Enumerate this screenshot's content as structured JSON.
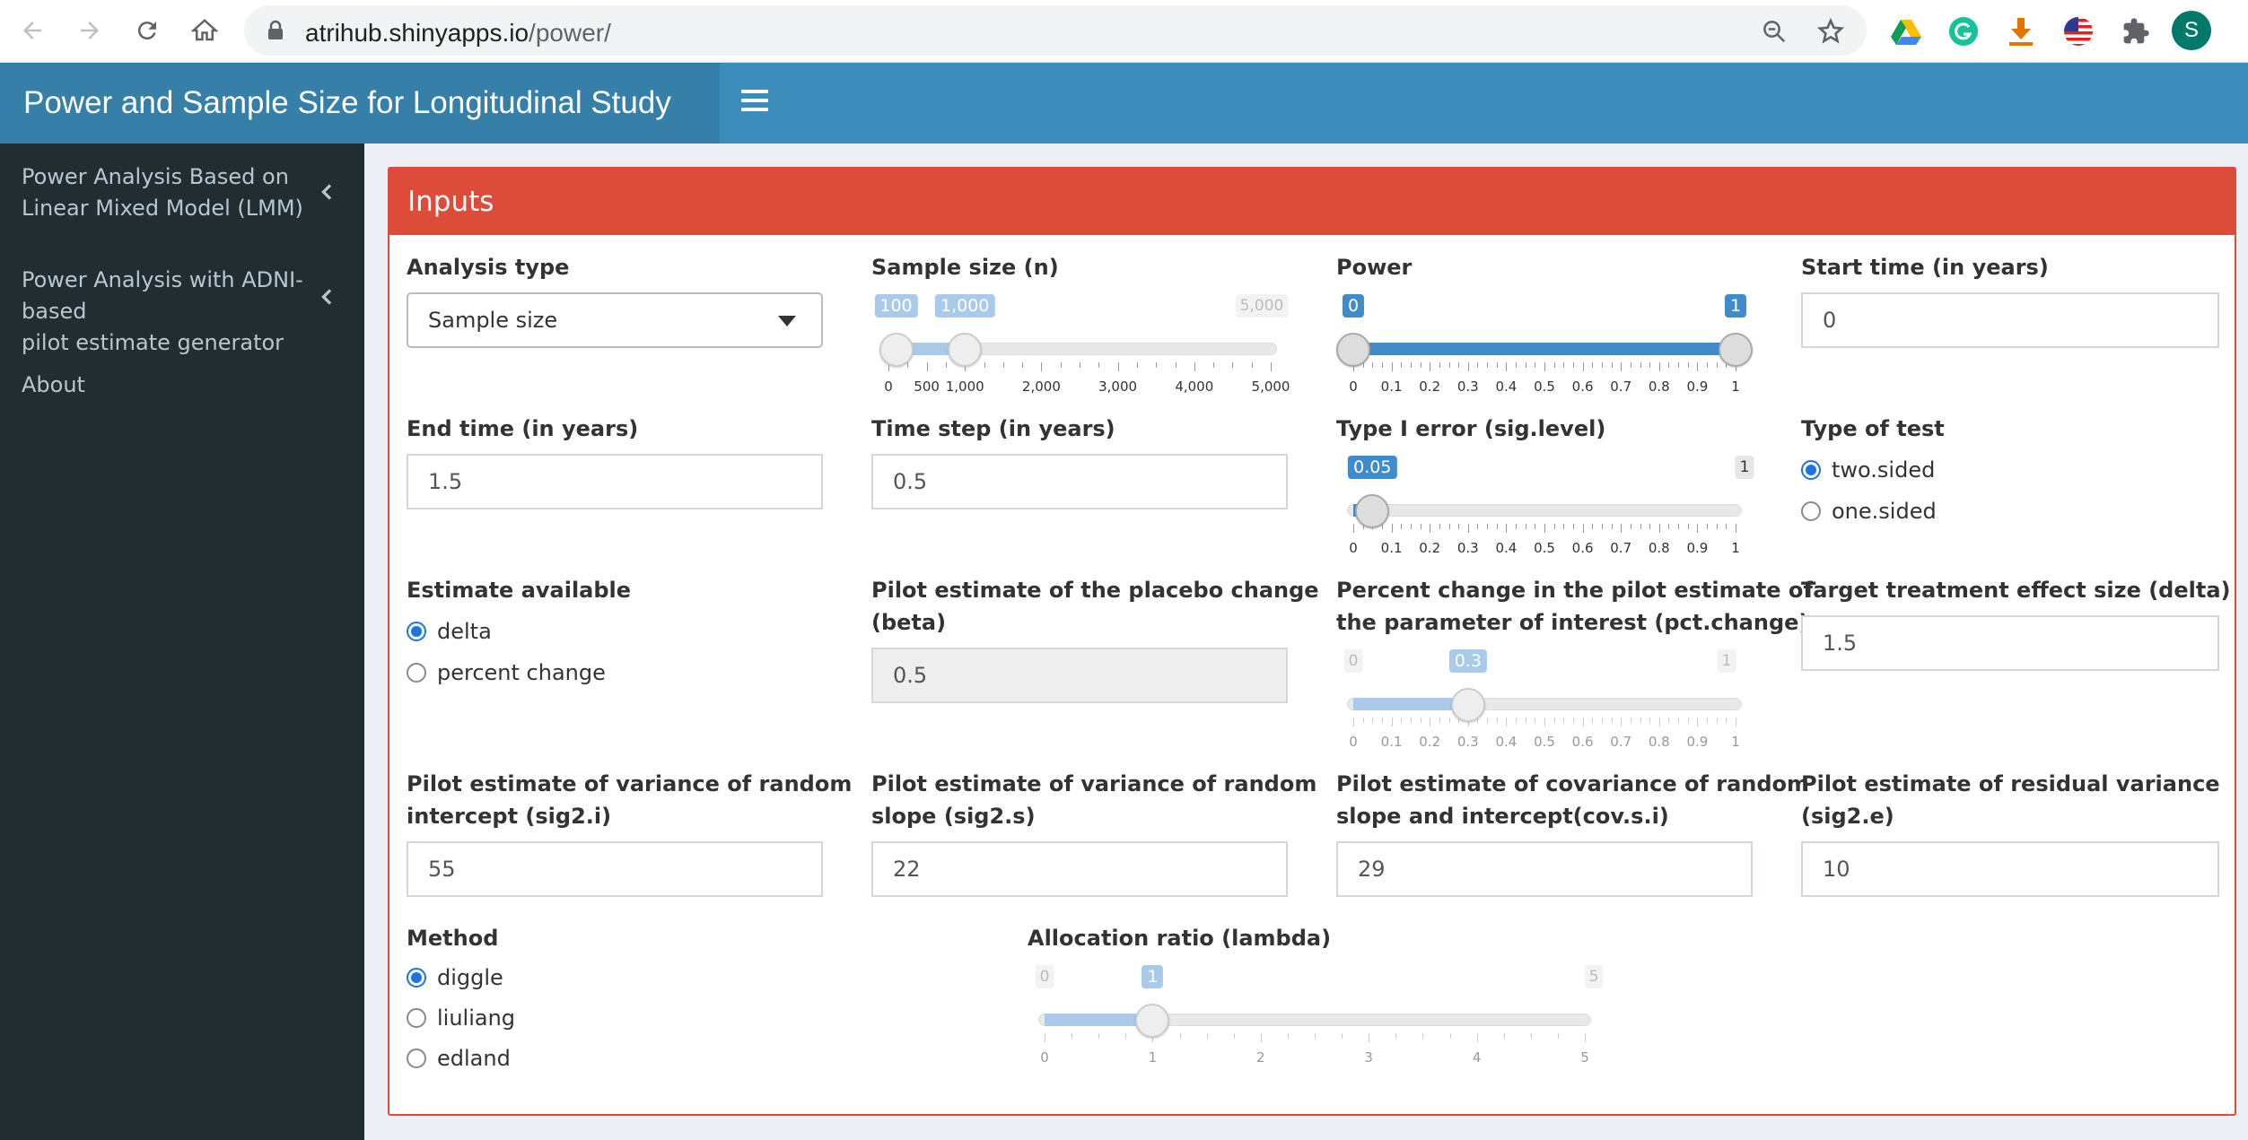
{
  "browser": {
    "url_host": "atrihub.shinyapps.io",
    "url_path": "/power/",
    "profile_initial": "S"
  },
  "header": {
    "title": "Power and Sample Size for Longitudinal Study"
  },
  "sidebar": {
    "items": [
      {
        "label_line1": "Power Analysis Based on",
        "label_line2": "Linear Mixed Model (LMM)"
      },
      {
        "label_line1": "Power Analysis with ADNI-based",
        "label_line2": "pilot estimate generator"
      },
      {
        "label_line1": "About",
        "label_line2": ""
      }
    ]
  },
  "box": {
    "title": "Inputs"
  },
  "fields": {
    "analysis_type": {
      "label": "Analysis type",
      "value": "Sample size"
    },
    "sample_size": {
      "label": "Sample size (n)",
      "min": 0,
      "max": 5000,
      "low": 100,
      "high": 1000,
      "low_text": "100",
      "high_text": "1,000",
      "max_text": "5,000",
      "ticks": [
        "0",
        "500",
        "1,000",
        "2,000",
        "3,000",
        "4,000",
        "5,000"
      ]
    },
    "power": {
      "label": "Power",
      "min": 0,
      "max": 1,
      "low": 0,
      "high": 1,
      "low_text": "0",
      "high_text": "1",
      "ticks": [
        "0",
        "0.1",
        "0.2",
        "0.3",
        "0.4",
        "0.5",
        "0.6",
        "0.7",
        "0.8",
        "0.9",
        "1"
      ]
    },
    "start_time": {
      "label": "Start time (in years)",
      "value": "0"
    },
    "end_time": {
      "label": "End time (in years)",
      "value": "1.5"
    },
    "time_step": {
      "label": "Time step (in years)",
      "value": "0.5"
    },
    "type1_error": {
      "label": "Type I error (sig.level)",
      "min": 0,
      "max": 1,
      "value": 0.05,
      "value_text": "0.05",
      "max_text": "1",
      "ticks": [
        "0",
        "0.1",
        "0.2",
        "0.3",
        "0.4",
        "0.5",
        "0.6",
        "0.7",
        "0.8",
        "0.9",
        "1"
      ]
    },
    "type_of_test": {
      "label": "Type of test",
      "options": [
        "two.sided",
        "one.sided"
      ],
      "selected": "two.sided"
    },
    "estimate_available": {
      "label": "Estimate available",
      "options": [
        "delta",
        "percent change"
      ],
      "selected": "delta"
    },
    "pilot_beta": {
      "label_line1": "Pilot estimate of the placebo change",
      "label_line2": "(beta)",
      "value": "0.5"
    },
    "pct_change": {
      "label_line1": "Percent change in the pilot estimate of",
      "label_line2": "the parameter of interest (pct.change)",
      "min": 0,
      "max": 1,
      "value": 0.3,
      "value_text": "0.3",
      "min_text": "0",
      "max_text": "1",
      "ticks": [
        "0",
        "0.1",
        "0.2",
        "0.3",
        "0.4",
        "0.5",
        "0.6",
        "0.7",
        "0.8",
        "0.9",
        "1"
      ]
    },
    "target_delta": {
      "label": "Target treatment effect size (delta)",
      "value": "1.5"
    },
    "sig2_i": {
      "label_line1": "Pilot estimate of variance of random",
      "label_line2": "intercept (sig2.i)",
      "value": "55"
    },
    "sig2_s": {
      "label_line1": "Pilot estimate of variance of random",
      "label_line2": "slope (sig2.s)",
      "value": "22"
    },
    "cov_s_i": {
      "label_line1": "Pilot estimate of covariance of random",
      "label_line2": "slope and intercept(cov.s.i)",
      "value": "29"
    },
    "sig2_e": {
      "label_line1": "Pilot estimate of residual variance",
      "label_line2": "(sig2.e)",
      "value": "10"
    },
    "method": {
      "label": "Method",
      "options": [
        "diggle",
        "liuliang",
        "edland"
      ],
      "selected": "diggle"
    },
    "lambda": {
      "label": "Allocation ratio (lambda)",
      "min": 0,
      "max": 5,
      "value": 1,
      "value_text": "1",
      "min_text": "0",
      "max_text": "5",
      "ticks": [
        "0",
        "1",
        "2",
        "3",
        "4",
        "5"
      ]
    }
  },
  "colors": {
    "header": "#3c8dbc",
    "logo": "#367fa9",
    "sidebar": "#222d32",
    "box_accent": "#dd4b39",
    "slider_blue": "#428bca",
    "slider_light": "#a9cbe9"
  }
}
